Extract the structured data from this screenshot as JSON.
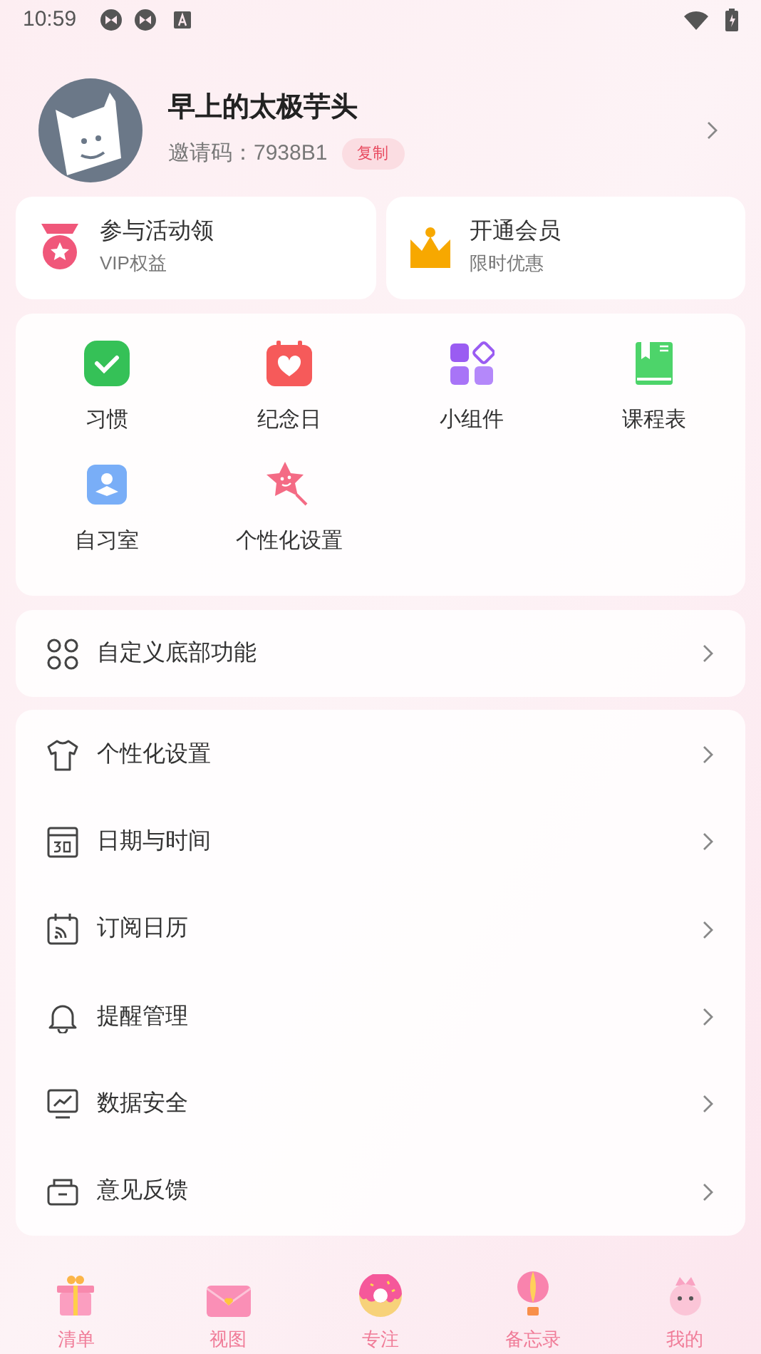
{
  "status_bar": {
    "time": "10:59"
  },
  "profile": {
    "name": "早上的太极芋头",
    "invite_label": "邀请码：",
    "invite_code": "7938B1",
    "copy_button": "复制"
  },
  "promo_cards": [
    {
      "title": "参与活动领",
      "subtitle": "VIP权益"
    },
    {
      "title": "开通会员",
      "subtitle": "限时优惠"
    }
  ],
  "features": [
    {
      "label": "习惯"
    },
    {
      "label": "纪念日"
    },
    {
      "label": "小组件"
    },
    {
      "label": "课程表"
    },
    {
      "label": "自习室"
    },
    {
      "label": "个性化设置"
    }
  ],
  "custom_bar": {
    "label": "自定义底部功能"
  },
  "settings": [
    {
      "label": "个性化设置"
    },
    {
      "label": "日期与时间"
    },
    {
      "label": "订阅日历"
    },
    {
      "label": "提醒管理"
    },
    {
      "label": "数据安全"
    },
    {
      "label": "意见反馈"
    }
  ],
  "bottom_nav": [
    {
      "label": "清单"
    },
    {
      "label": "视图"
    },
    {
      "label": "专注"
    },
    {
      "label": "备忘录"
    },
    {
      "label": "我的"
    }
  ]
}
